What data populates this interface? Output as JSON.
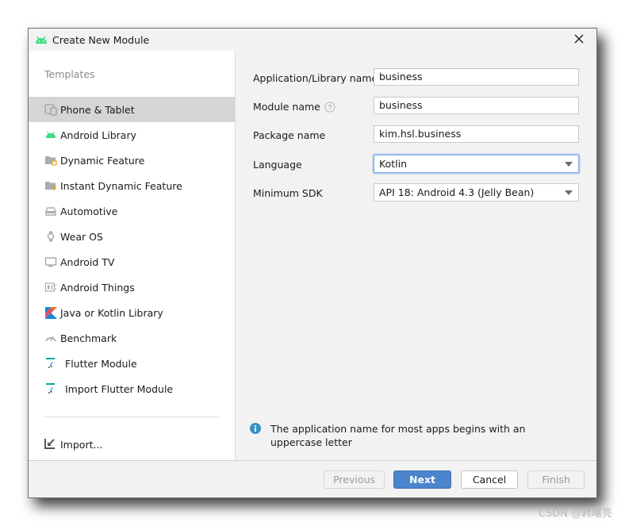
{
  "window": {
    "title": "Create New Module",
    "app_icon": "android-icon"
  },
  "sidebar": {
    "heading": "Templates",
    "items": [
      {
        "label": "Phone & Tablet",
        "icon": "phone-tablet-icon",
        "selected": true
      },
      {
        "label": "Android Library",
        "icon": "android-icon"
      },
      {
        "label": "Dynamic Feature",
        "icon": "dynamic-feature-icon"
      },
      {
        "label": "Instant Dynamic Feature",
        "icon": "instant-dynamic-feature-icon"
      },
      {
        "label": "Automotive",
        "icon": "car-icon"
      },
      {
        "label": "Wear OS",
        "icon": "watch-icon"
      },
      {
        "label": "Android TV",
        "icon": "tv-icon"
      },
      {
        "label": "Android Things",
        "icon": "things-board-icon"
      },
      {
        "label": "Java or Kotlin Library",
        "icon": "kotlin-icon"
      },
      {
        "label": "Benchmark",
        "icon": "gauge-icon"
      },
      {
        "label": "Flutter Module",
        "icon": "flutter-icon"
      },
      {
        "label": "Import Flutter Module",
        "icon": "flutter-icon"
      }
    ],
    "import_label": "Import..."
  },
  "form": {
    "app_name": {
      "label": "Application/Library name",
      "value": "business"
    },
    "module_name": {
      "label": "Module name",
      "value": "business"
    },
    "package_name": {
      "label": "Package name",
      "value": "kim.hsl.business"
    },
    "language": {
      "label": "Language",
      "value": "Kotlin"
    },
    "min_sdk": {
      "label": "Minimum SDK",
      "value": "API 18: Android 4.3 (Jelly Bean)"
    }
  },
  "info_message": "The application name for most apps begins with an uppercase letter",
  "footer": {
    "previous": "Previous",
    "next": "Next",
    "cancel": "Cancel",
    "finish": "Finish"
  },
  "watermark": "CSDN @韩曙亮",
  "colors": {
    "android_green": "#3ddc84",
    "primary_button": "#4a84cc",
    "info_blue": "#3592c4",
    "flutter_teal": "#02a59b"
  }
}
